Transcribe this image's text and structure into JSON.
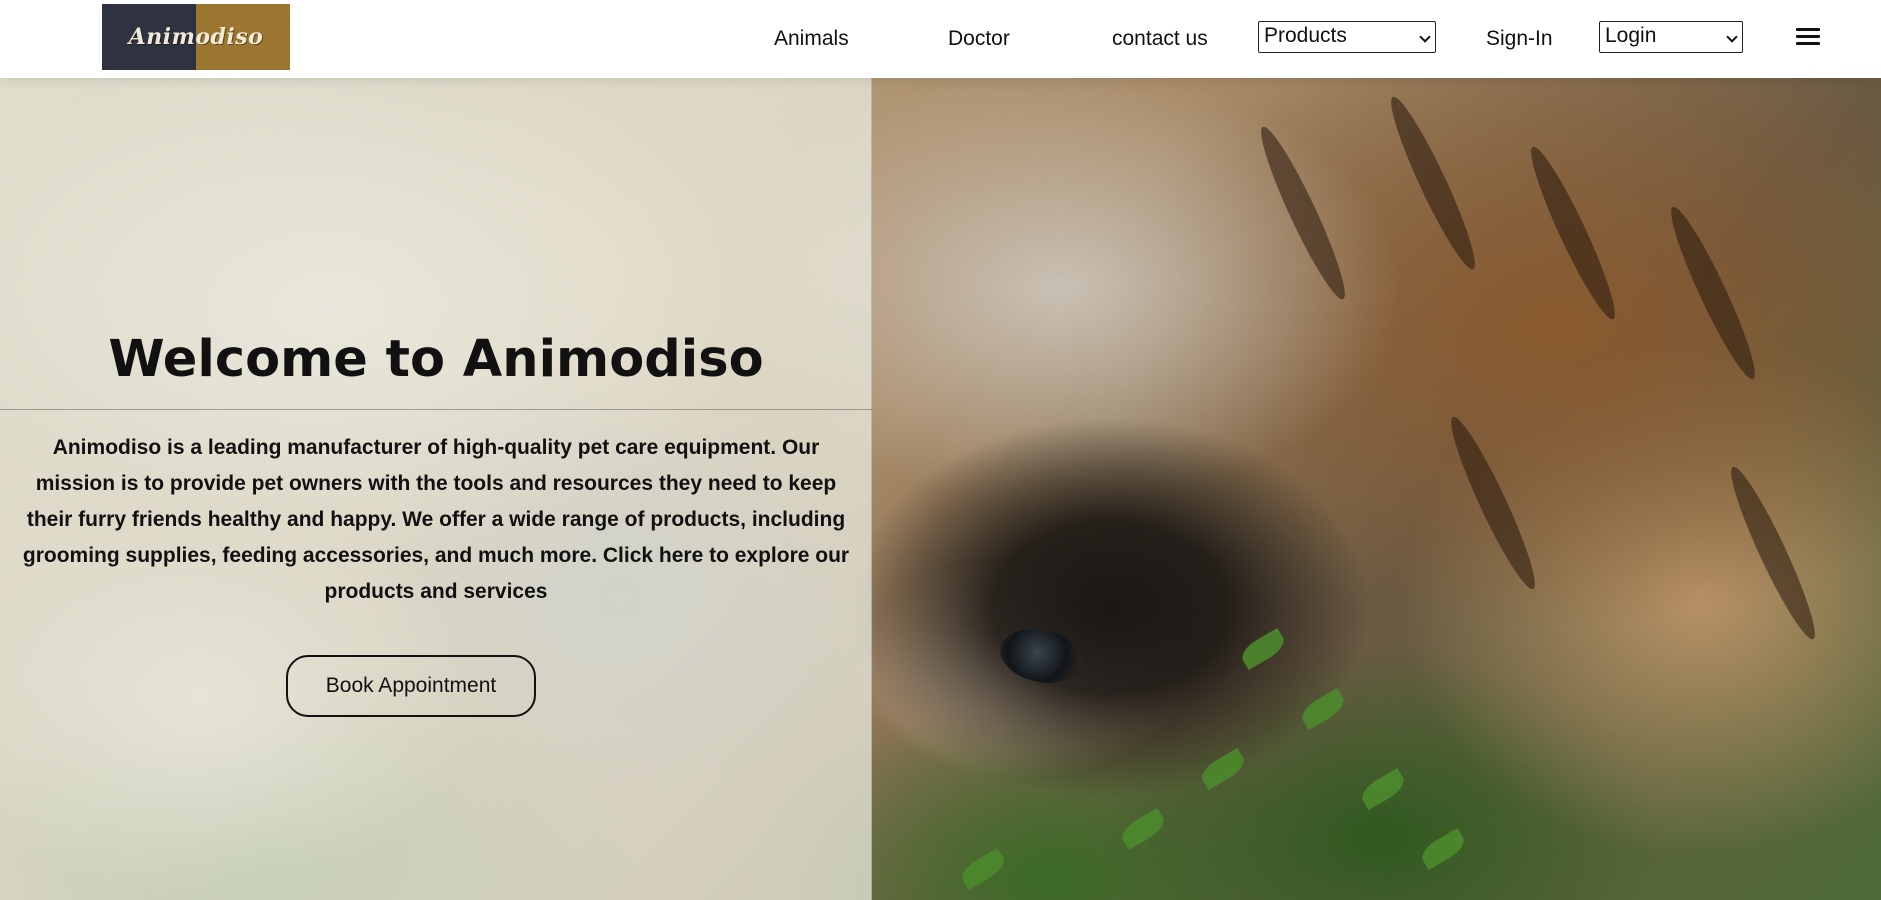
{
  "header": {
    "logo_text": "Animodiso",
    "nav": {
      "animals": "Animals",
      "doctor": "Doctor",
      "contact": "contact us",
      "signin": "Sign-In"
    },
    "products_select": {
      "selected": "Products"
    },
    "login_select": {
      "selected": "Login"
    },
    "menu_icon": "hamburger-menu-icon"
  },
  "hero": {
    "title": "Welcome to Animodiso",
    "description": "Animodiso is a leading manufacturer of high-quality pet care equipment. Our mission is to provide pet owners with the tools and resources they need to keep their furry friends healthy and happy. We offer a wide range of products, including grooming supplies, feeding accessories, and much more. Click here to explore our products and services",
    "cta_label": "Book Appointment"
  },
  "colors": {
    "logo_left": "#2f3240",
    "logo_right": "#9c7630",
    "overlay": "#e8eade"
  }
}
